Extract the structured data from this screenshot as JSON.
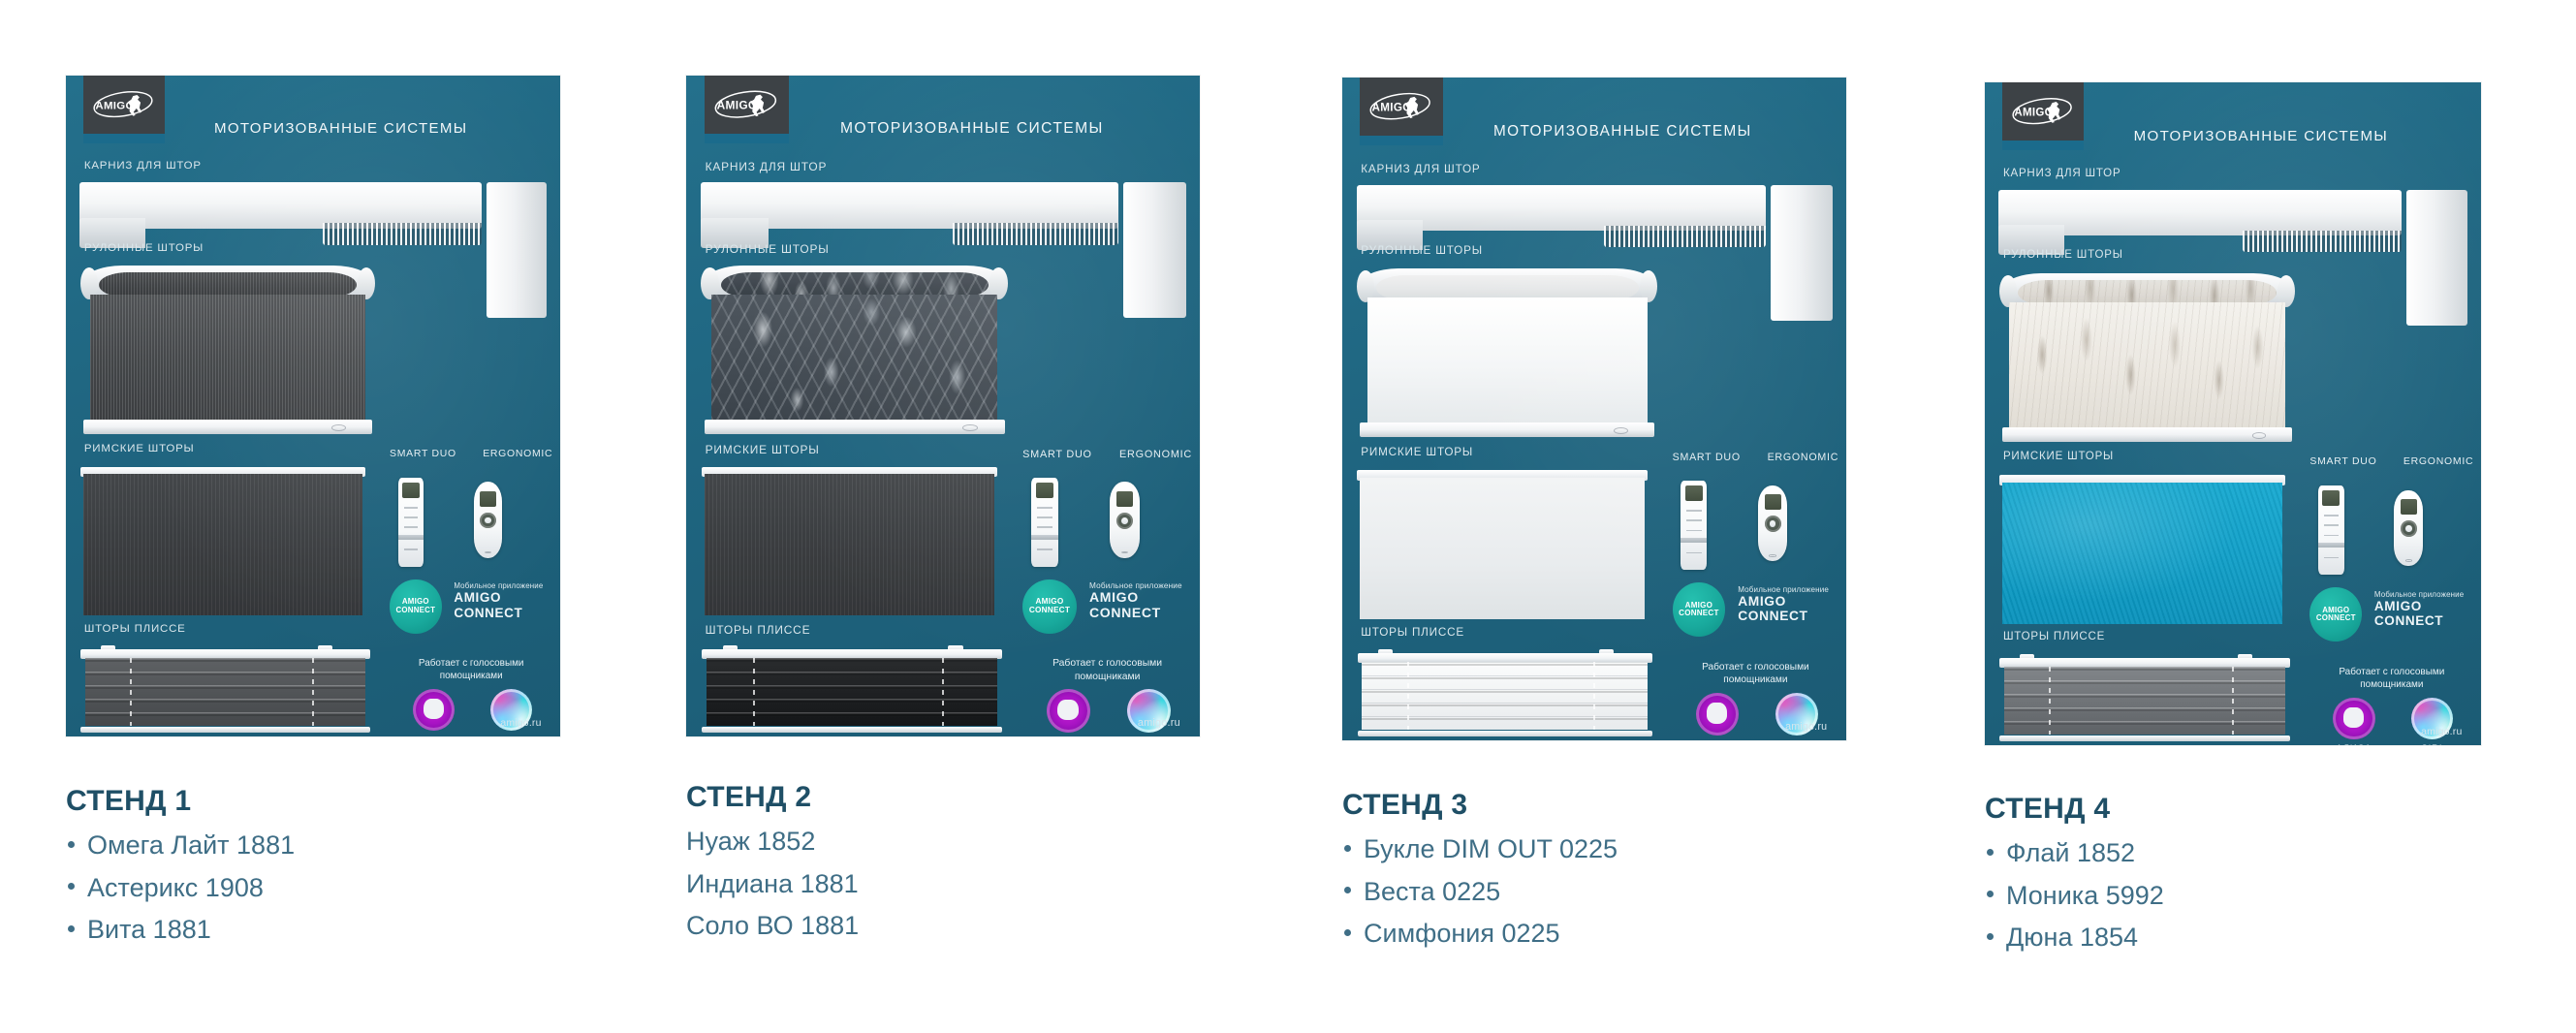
{
  "brand": {
    "logo_text": "AMIGO",
    "site": "amigo.ru",
    "accent_blue": "#1b6b8c",
    "board_teal": "#1f6580",
    "caption_title_color": "#1f4f66",
    "caption_text_color": "#3f6e86"
  },
  "board": {
    "title": "МОТОРИЗОВАННЫЕ СИСТЕМЫ",
    "sections": {
      "cornice": "КАРНИЗ ДЛЯ ШТОР",
      "roller": "РУЛОННЫЕ ШТОРЫ",
      "roman": "РИМСКИЕ ШТОРЫ",
      "pleated": "ШТОРЫ ПЛИССЕ"
    },
    "remotes": [
      {
        "label": "SMART DUO",
        "type": "smart-duo-remote"
      },
      {
        "label": "ERGONOMIC",
        "type": "ergonomic-remote"
      }
    ],
    "app": {
      "badge_line1": "AMIGO",
      "badge_line2": "CONNECT",
      "kicker": "Мобильное приложение",
      "name_line1": "AMIGO",
      "name_line2": "CONNECT"
    },
    "voice": {
      "title": "Работает с голосовыми\nпомощниками",
      "assistants": [
        {
          "name": "АЛИСА",
          "icon": "alisa-icon"
        },
        {
          "name": "SIRI",
          "icon": "siri-icon"
        }
      ]
    }
  },
  "stands": [
    {
      "id": "stand-1",
      "title": "СТЕНД 1",
      "bulleted": true,
      "fabrics": [
        "Омега Лайт 1881",
        "Астерикс 1908",
        "Вита 1881"
      ],
      "swatches": {
        "roller": "dark-grey-textured",
        "roman": "dark-charcoal",
        "pleated": "dark-grey"
      }
    },
    {
      "id": "stand-2",
      "title": "СТЕНД 2",
      "bulleted": false,
      "fabrics": [
        "Нуаж 1852",
        "Индиана 1881",
        "Соло ВО 1881"
      ],
      "swatches": {
        "roller": "botanical-leaf-grey",
        "roman": "dark-charcoal",
        "pleated": "black"
      }
    },
    {
      "id": "stand-3",
      "title": "СТЕНД 3",
      "bulleted": true,
      "fabrics": [
        "Букле DIM OUT 0225",
        "Веста 0225",
        "Симфония 0225"
      ],
      "swatches": {
        "roller": "white",
        "roman": "off-white",
        "pleated": "white"
      }
    },
    {
      "id": "stand-4",
      "title": "СТЕНД 4",
      "bulleted": true,
      "fabrics": [
        "Флай 1852",
        "Моника 5992",
        "Дюна 1854"
      ],
      "swatches": {
        "roller": "beige-feather",
        "roman": "turquoise",
        "pleated": "grey"
      }
    }
  ]
}
